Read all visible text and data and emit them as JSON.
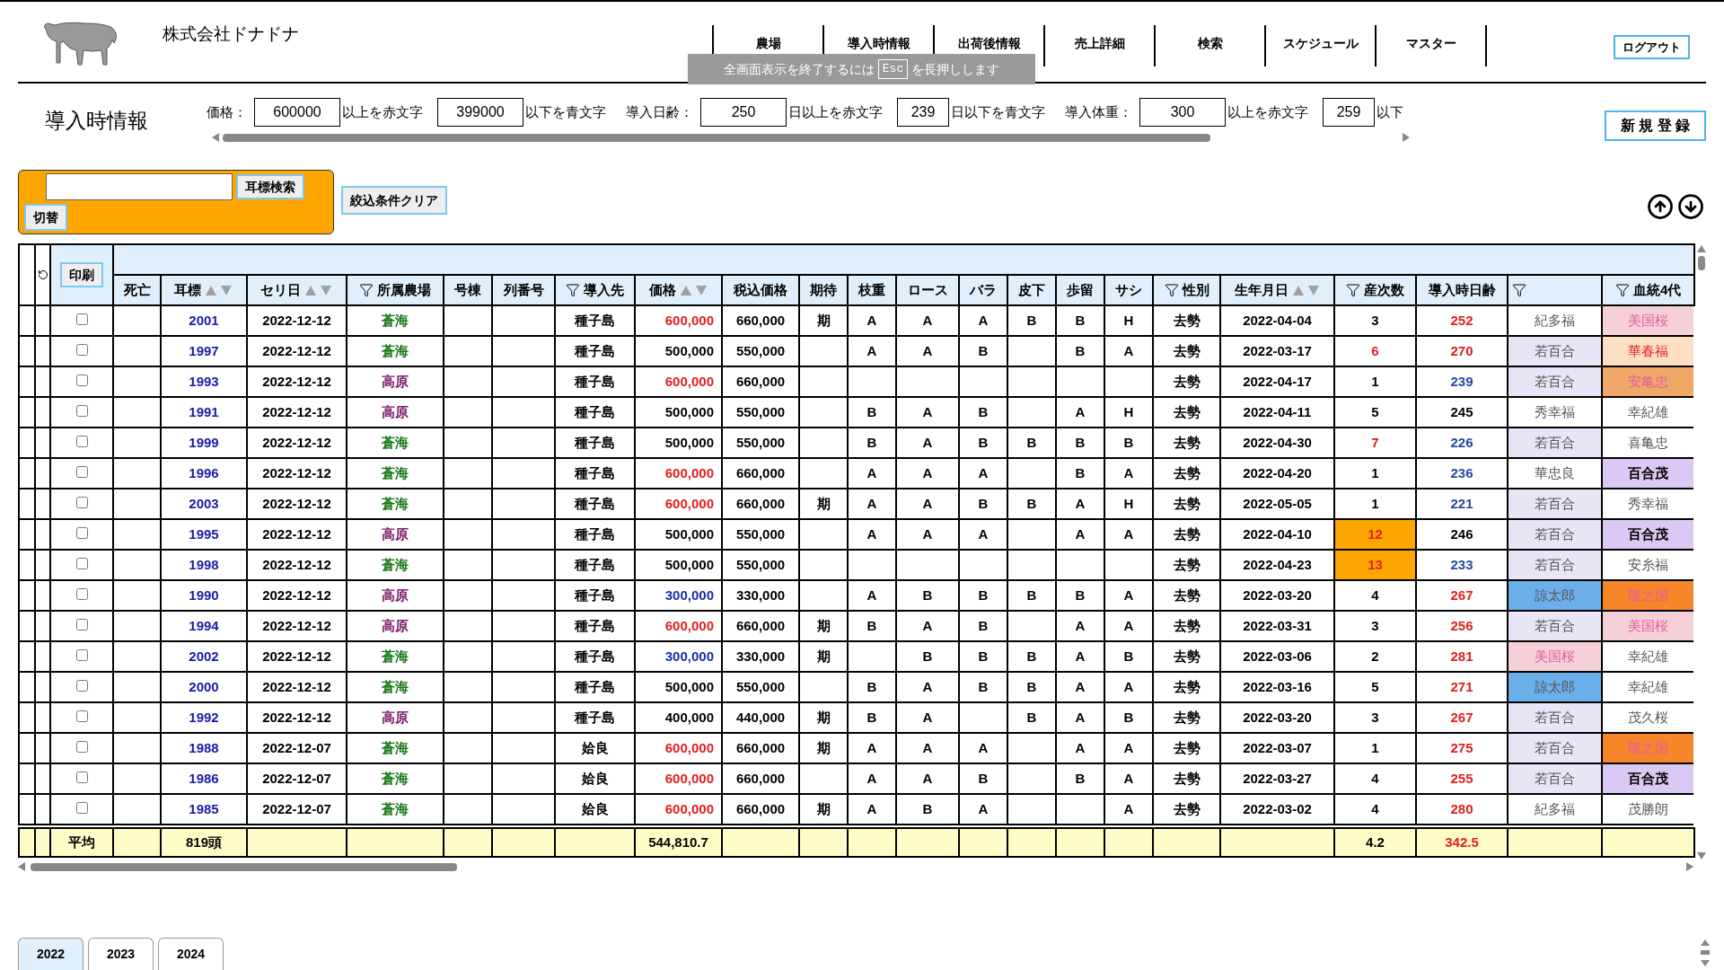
{
  "header": {
    "company": "株式会社ドナドナ",
    "nav": [
      {
        "label": "農場",
        "selected": false
      },
      {
        "label": "導入時情報",
        "selected": false
      },
      {
        "label": "出荷後情報",
        "selected": false
      },
      {
        "label": "売上詳細",
        "selected": false
      },
      {
        "label": "検索",
        "selected": false
      },
      {
        "label": "スケジュール",
        "selected": false
      },
      {
        "label": "マスター",
        "selected": false
      }
    ],
    "logout": "ログアウト"
  },
  "fullscreen_notice": {
    "before": "全画面表示を終了するには",
    "key": "Esc",
    "after": "を長押しします"
  },
  "page_title": "導入時情報",
  "thresholds": [
    {
      "label": "価格：",
      "high": "600000",
      "high_text": "以上を赤文字",
      "low": "399000",
      "low_text": "以下を青文字"
    },
    {
      "label": "導入日齢：",
      "high": "250",
      "high_text": "日以上を赤文字",
      "low": "239",
      "low_text": "日以下を青文字"
    },
    {
      "label": "導入体重：",
      "high": "300",
      "high_text": "以上を赤文字",
      "low": "259",
      "low_text": "以下"
    }
  ],
  "new_button": "新 規 登 録",
  "ear_search": {
    "button": "耳標検索",
    "toggle": "切替"
  },
  "clear_button": "絞込条件クリア",
  "print_button": "印刷",
  "columns": [
    {
      "label": "死亡",
      "sort": false,
      "filter": false
    },
    {
      "label": "耳標",
      "sort": true,
      "filter": false
    },
    {
      "label": "セリ日",
      "sort": true,
      "filter": false
    },
    {
      "label": "所属農場",
      "sort": false,
      "filter": true
    },
    {
      "label": "号棟",
      "sort": false,
      "filter": false
    },
    {
      "label": "列番号",
      "sort": false,
      "filter": false
    },
    {
      "label": "導入先",
      "sort": false,
      "filter": true
    },
    {
      "label": "価格",
      "sort": true,
      "filter": false
    },
    {
      "label": "税込価格",
      "sort": false,
      "filter": false
    },
    {
      "label": "期待",
      "sort": false,
      "filter": false
    },
    {
      "label": "枝重",
      "sort": false,
      "filter": false
    },
    {
      "label": "ロース",
      "sort": false,
      "filter": false
    },
    {
      "label": "バラ",
      "sort": false,
      "filter": false
    },
    {
      "label": "皮下",
      "sort": false,
      "filter": false
    },
    {
      "label": "歩留",
      "sort": false,
      "filter": false
    },
    {
      "label": "サシ",
      "sort": false,
      "filter": false
    },
    {
      "label": "性別",
      "sort": false,
      "filter": true
    },
    {
      "label": "生年月日",
      "sort": true,
      "filter": false
    },
    {
      "label": "産次数",
      "sort": false,
      "filter": true
    },
    {
      "label": "導入時日齢",
      "sort": false,
      "filter": false
    },
    {
      "sort": false,
      "filter": true
    },
    {
      "label": "血統4代",
      "sort": false,
      "filter": true
    }
  ],
  "rows": [
    {
      "checked": false,
      "ear": "2001",
      "date": "2022-12-12",
      "farm": {
        "text": "蒼海",
        "kind": "sokai"
      },
      "dest": "種子島",
      "price": {
        "text": "600,000",
        "color": "#e02020"
      },
      "tax": "660,000",
      "expect": "期",
      "grades": {
        "eda": "A",
        "loin": "A",
        "bara": "A",
        "hika": "B",
        "budomari": "B",
        "sashi": "H"
      },
      "sex": "去勢",
      "birth": "2022-04-04",
      "parity": {
        "text": "3",
        "color": "#000000",
        "highlight": false
      },
      "age": {
        "text": "252",
        "color": "#e02020"
      },
      "pedigree": [
        {
          "text": "紀多福",
          "kind": "plain",
          "color": "#ffffff"
        },
        {
          "text": "美国桜",
          "kind": "pink",
          "color": "#f5d0d8"
        }
      ]
    },
    {
      "checked": false,
      "ear": "1997",
      "date": "2022-12-12",
      "farm": {
        "text": "蒼海",
        "kind": "sokai"
      },
      "dest": "種子島",
      "price": {
        "text": "500,000",
        "color": "#000000"
      },
      "tax": "550,000",
      "grades": {
        "eda": "A",
        "loin": "A",
        "bara": "B",
        "budomari": "B",
        "sashi": "A"
      },
      "sex": "去勢",
      "birth": "2022-03-17",
      "parity": {
        "text": "6",
        "color": "#e02020",
        "highlight": false
      },
      "age": {
        "text": "270",
        "color": "#e02020"
      },
      "pedigree": [
        {
          "text": "若百合",
          "kind": "plain",
          "color": "#e8e6f6"
        },
        {
          "text": "華春福",
          "kind": "red",
          "color": "#fde0c4"
        }
      ]
    },
    {
      "checked": false,
      "ear": "1993",
      "date": "2022-12-12",
      "farm": {
        "text": "高原",
        "kind": "kogen"
      },
      "dest": "種子島",
      "price": {
        "text": "600,000",
        "color": "#e02020"
      },
      "tax": "660,000",
      "grades": {},
      "sex": "去勢",
      "birth": "2022-04-17",
      "parity": {
        "text": "1",
        "color": "#000000",
        "highlight": false
      },
      "age": {
        "text": "239",
        "color": "#2a4aa0"
      },
      "pedigree": [
        {
          "text": "若百合",
          "kind": "plain",
          "color": "#e8e6f6"
        },
        {
          "text": "安亀忠",
          "kind": "pink",
          "color": "#f0a868"
        }
      ]
    },
    {
      "checked": false,
      "ear": "1991",
      "date": "2022-12-12",
      "farm": {
        "text": "高原",
        "kind": "kogen"
      },
      "dest": "種子島",
      "price": {
        "text": "500,000",
        "color": "#000000"
      },
      "tax": "550,000",
      "grades": {
        "eda": "B",
        "loin": "A",
        "bara": "B",
        "budomari": "A",
        "sashi": "H"
      },
      "sex": "去勢",
      "birth": "2022-04-11",
      "parity": {
        "text": "5",
        "color": "#000000",
        "highlight": false
      },
      "age": {
        "text": "245",
        "color": "#000000"
      },
      "pedigree": [
        {
          "text": "秀幸福",
          "kind": "plain",
          "color": "#ffffff"
        },
        {
          "text": "幸紀雄",
          "kind": "plain",
          "color": "#ffffff"
        }
      ]
    },
    {
      "checked": false,
      "ear": "1999",
      "date": "2022-12-12",
      "farm": {
        "text": "蒼海",
        "kind": "sokai"
      },
      "dest": "種子島",
      "price": {
        "text": "500,000",
        "color": "#000000"
      },
      "tax": "550,000",
      "grades": {
        "eda": "B",
        "loin": "A",
        "bara": "B",
        "hika": "B",
        "budomari": "B",
        "sashi": "B"
      },
      "sex": "去勢",
      "birth": "2022-04-30",
      "parity": {
        "text": "7",
        "color": "#e02020",
        "highlight": false
      },
      "age": {
        "text": "226",
        "color": "#2a4aa0"
      },
      "pedigree": [
        {
          "text": "若百合",
          "kind": "plain",
          "color": "#e8e6f6"
        },
        {
          "text": "喜亀忠",
          "kind": "plain",
          "color": "#ffffff"
        }
      ]
    },
    {
      "checked": false,
      "ear": "1996",
      "date": "2022-12-12",
      "farm": {
        "text": "蒼海",
        "kind": "sokai"
      },
      "dest": "種子島",
      "price": {
        "text": "600,000",
        "color": "#e02020"
      },
      "tax": "660,000",
      "grades": {
        "eda": "A",
        "loin": "A",
        "bara": "A",
        "budomari": "B",
        "sashi": "A"
      },
      "sex": "去勢",
      "birth": "2022-04-20",
      "parity": {
        "text": "1",
        "color": "#000000",
        "highlight": false
      },
      "age": {
        "text": "236",
        "color": "#2a4aa0"
      },
      "pedigree": [
        {
          "text": "華忠良",
          "kind": "plain",
          "color": "#ffffff"
        },
        {
          "text": "百合茂",
          "kind": "bold",
          "color": "#dcc8f4"
        }
      ]
    },
    {
      "checked": false,
      "ear": "2003",
      "date": "2022-12-12",
      "farm": {
        "text": "蒼海",
        "kind": "sokai"
      },
      "dest": "種子島",
      "price": {
        "text": "600,000",
        "color": "#e02020"
      },
      "tax": "660,000",
      "expect": "期",
      "grades": {
        "eda": "A",
        "loin": "A",
        "bara": "B",
        "hika": "B",
        "budomari": "A",
        "sashi": "H"
      },
      "sex": "去勢",
      "birth": "2022-05-05",
      "parity": {
        "text": "1",
        "color": "#000000",
        "highlight": false
      },
      "age": {
        "text": "221",
        "color": "#2a4aa0"
      },
      "pedigree": [
        {
          "text": "若百合",
          "kind": "plain",
          "color": "#e8e6f6"
        },
        {
          "text": "秀幸福",
          "kind": "plain",
          "color": "#ffffff"
        }
      ]
    },
    {
      "checked": false,
      "ear": "1995",
      "date": "2022-12-12",
      "farm": {
        "text": "高原",
        "kind": "kogen"
      },
      "dest": "種子島",
      "price": {
        "text": "500,000",
        "color": "#000000"
      },
      "tax": "550,000",
      "grades": {
        "eda": "A",
        "loin": "A",
        "bara": "A",
        "budomari": "A",
        "sashi": "A"
      },
      "sex": "去勢",
      "birth": "2022-04-10",
      "parity": {
        "text": "12",
        "color": "#e02020",
        "highlight": true
      },
      "age": {
        "text": "246",
        "color": "#000000"
      },
      "pedigree": [
        {
          "text": "若百合",
          "kind": "plain",
          "color": "#e8e6f6"
        },
        {
          "text": "百合茂",
          "kind": "bold",
          "color": "#dcc8f4"
        }
      ]
    },
    {
      "checked": false,
      "ear": "1998",
      "date": "2022-12-12",
      "farm": {
        "text": "蒼海",
        "kind": "sokai"
      },
      "dest": "種子島",
      "price": {
        "text": "500,000",
        "color": "#000000"
      },
      "tax": "550,000",
      "grades": {},
      "sex": "去勢",
      "birth": "2022-04-23",
      "parity": {
        "text": "13",
        "color": "#e02020",
        "highlight": true
      },
      "age": {
        "text": "233",
        "color": "#2a4aa0"
      },
      "pedigree": [
        {
          "text": "若百合",
          "kind": "plain",
          "color": "#e8e6f6"
        },
        {
          "text": "安糸福",
          "kind": "plain",
          "color": "#ffffff"
        }
      ]
    },
    {
      "checked": false,
      "ear": "1990",
      "date": "2022-12-12",
      "farm": {
        "text": "高原",
        "kind": "kogen"
      },
      "dest": "種子島",
      "price": {
        "text": "300,000",
        "color": "#1a2fa8"
      },
      "tax": "330,000",
      "grades": {
        "eda": "A",
        "loin": "B",
        "bara": "B",
        "hika": "B",
        "budomari": "B",
        "sashi": "A"
      },
      "sex": "去勢",
      "birth": "2022-03-20",
      "parity": {
        "text": "4",
        "color": "#000000",
        "highlight": false
      },
      "age": {
        "text": "267",
        "color": "#e02020"
      },
      "pedigree": [
        {
          "text": "諒太郎",
          "kind": "plain",
          "color": "#6aaeea"
        },
        {
          "text": "隆之国",
          "kind": "pink",
          "color": "#f7862a"
        }
      ]
    },
    {
      "checked": false,
      "ear": "1994",
      "date": "2022-12-12",
      "farm": {
        "text": "高原",
        "kind": "kogen"
      },
      "dest": "種子島",
      "price": {
        "text": "600,000",
        "color": "#e02020"
      },
      "tax": "660,000",
      "expect": "期",
      "grades": {
        "eda": "B",
        "loin": "A",
        "bara": "B",
        "budomari": "A",
        "sashi": "A"
      },
      "sex": "去勢",
      "birth": "2022-03-31",
      "parity": {
        "text": "3",
        "color": "#000000",
        "highlight": false
      },
      "age": {
        "text": "256",
        "color": "#e02020"
      },
      "pedigree": [
        {
          "text": "若百合",
          "kind": "plain",
          "color": "#e8e6f6"
        },
        {
          "text": "美国桜",
          "kind": "pink",
          "color": "#f5d0d8"
        }
      ]
    },
    {
      "checked": false,
      "ear": "2002",
      "date": "2022-12-12",
      "farm": {
        "text": "蒼海",
        "kind": "sokai"
      },
      "dest": "種子島",
      "price": {
        "text": "300,000",
        "color": "#1a2fa8"
      },
      "tax": "330,000",
      "expect": "期",
      "grades": {
        "loin": "B",
        "bara": "B",
        "hika": "B",
        "budomari": "A",
        "sashi": "B"
      },
      "sex": "去勢",
      "birth": "2022-03-06",
      "parity": {
        "text": "2",
        "color": "#000000",
        "highlight": false
      },
      "age": {
        "text": "281",
        "color": "#e02020"
      },
      "pedigree": [
        {
          "text": "美国桜",
          "kind": "pink",
          "color": "#f5d0d8"
        },
        {
          "text": "幸紀雄",
          "kind": "plain",
          "color": "#ffffff"
        }
      ]
    },
    {
      "checked": false,
      "ear": "2000",
      "date": "2022-12-12",
      "farm": {
        "text": "蒼海",
        "kind": "sokai"
      },
      "dest": "種子島",
      "price": {
        "text": "500,000",
        "color": "#000000"
      },
      "tax": "550,000",
      "grades": {
        "eda": "B",
        "loin": "A",
        "bara": "B",
        "hika": "B",
        "budomari": "A",
        "sashi": "A"
      },
      "sex": "去勢",
      "birth": "2022-03-16",
      "parity": {
        "text": "5",
        "color": "#000000",
        "highlight": false
      },
      "age": {
        "text": "271",
        "color": "#e02020"
      },
      "pedigree": [
        {
          "text": "諒太郎",
          "kind": "plain",
          "color": "#6aaeea"
        },
        {
          "text": "幸紀雄",
          "kind": "plain",
          "color": "#ffffff"
        }
      ]
    },
    {
      "checked": false,
      "ear": "1992",
      "date": "2022-12-12",
      "farm": {
        "text": "高原",
        "kind": "kogen"
      },
      "dest": "種子島",
      "price": {
        "text": "400,000",
        "color": "#000000"
      },
      "tax": "440,000",
      "expect": "期",
      "grades": {
        "eda": "B",
        "loin": "A",
        "hika": "B",
        "budomari": "A",
        "sashi": "B"
      },
      "sex": "去勢",
      "birth": "2022-03-20",
      "parity": {
        "text": "3",
        "color": "#000000",
        "highlight": false
      },
      "age": {
        "text": "267",
        "color": "#e02020"
      },
      "pedigree": [
        {
          "text": "若百合",
          "kind": "plain",
          "color": "#e8e6f6"
        },
        {
          "text": "茂久桜",
          "kind": "plain",
          "color": "#ffffff"
        }
      ]
    },
    {
      "checked": false,
      "ear": "1988",
      "date": "2022-12-07",
      "farm": {
        "text": "蒼海",
        "kind": "sokai"
      },
      "dest": "姶良",
      "price": {
        "text": "600,000",
        "color": "#e02020"
      },
      "tax": "660,000",
      "expect": "期",
      "grades": {
        "eda": "A",
        "loin": "A",
        "bara": "A",
        "budomari": "A",
        "sashi": "A"
      },
      "sex": "去勢",
      "birth": "2022-03-07",
      "parity": {
        "text": "1",
        "color": "#000000",
        "highlight": false
      },
      "age": {
        "text": "275",
        "color": "#e02020"
      },
      "pedigree": [
        {
          "text": "若百合",
          "kind": "plain",
          "color": "#e8e6f6"
        },
        {
          "text": "隆之国",
          "kind": "pink",
          "color": "#f7862a"
        }
      ]
    },
    {
      "checked": false,
      "ear": "1986",
      "date": "2022-12-07",
      "farm": {
        "text": "蒼海",
        "kind": "sokai"
      },
      "dest": "姶良",
      "price": {
        "text": "600,000",
        "color": "#e02020"
      },
      "tax": "660,000",
      "grades": {
        "eda": "A",
        "loin": "A",
        "bara": "B",
        "budomari": "B",
        "sashi": "A"
      },
      "sex": "去勢",
      "birth": "2022-03-27",
      "parity": {
        "text": "4",
        "color": "#000000",
        "highlight": false
      },
      "age": {
        "text": "255",
        "color": "#e02020"
      },
      "pedigree": [
        {
          "text": "若百合",
          "kind": "plain",
          "color": "#e8e6f6"
        },
        {
          "text": "百合茂",
          "kind": "bold",
          "color": "#dcc8f4"
        }
      ]
    },
    {
      "checked": false,
      "ear": "1985",
      "date": "2022-12-07",
      "farm": {
        "text": "蒼海",
        "kind": "sokai"
      },
      "dest": "姶良",
      "price": {
        "text": "600,000",
        "color": "#e02020"
      },
      "tax": "660,000",
      "expect": "期",
      "grades": {
        "eda": "A",
        "loin": "B",
        "bara": "A",
        "sashi": "A"
      },
      "sex": "去勢",
      "birth": "2022-03-02",
      "parity": {
        "text": "4",
        "color": "#000000",
        "highlight": false
      },
      "age": {
        "text": "280",
        "color": "#e02020"
      },
      "pedigree": [
        {
          "text": "紀多福",
          "kind": "plain",
          "color": "#ffffff"
        },
        {
          "text": "茂勝朗",
          "kind": "plain",
          "color": "#ffffff"
        }
      ]
    }
  ],
  "footer": {
    "label": "平均",
    "count": "819頭",
    "price": "544,810.7",
    "parity": "4.2",
    "age": "342.5"
  },
  "year_tabs": [
    {
      "label": "2022",
      "selected": true
    },
    {
      "label": "2023",
      "selected": false
    },
    {
      "label": "2024",
      "selected": false
    }
  ]
}
